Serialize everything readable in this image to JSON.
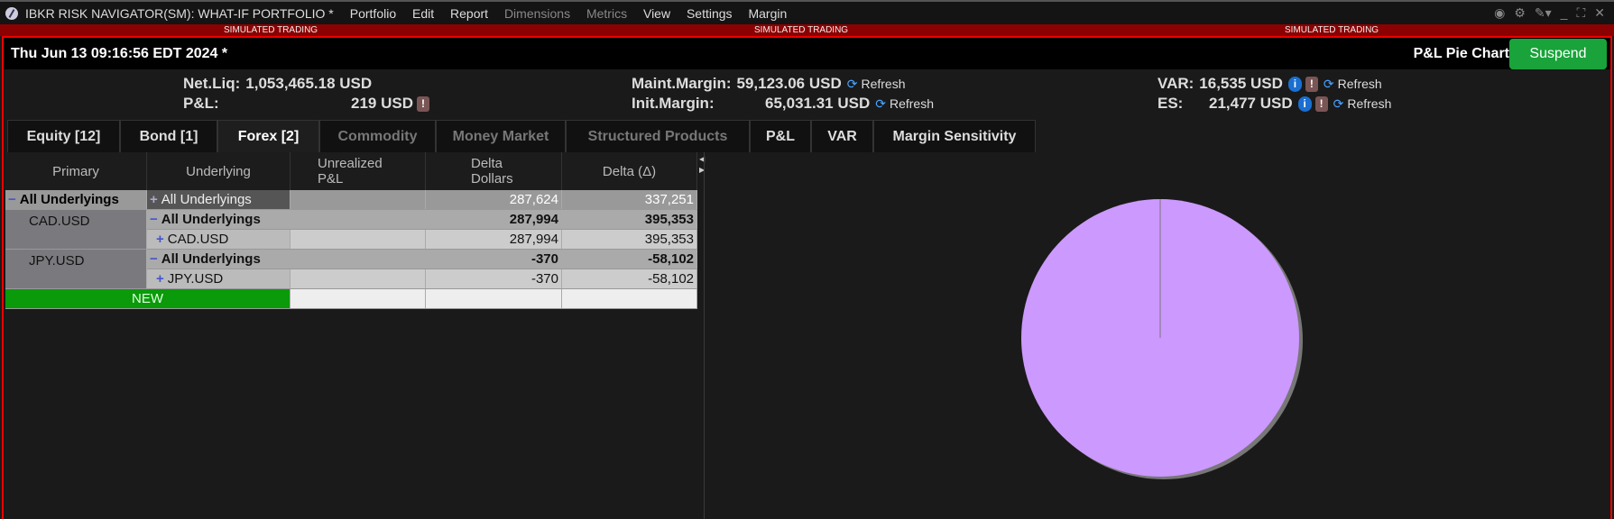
{
  "window": {
    "title": "IBKR RISK NAVIGATOR(SM): WHAT-IF PORTFOLIO *",
    "menu": [
      {
        "label": "Portfolio",
        "enabled": true
      },
      {
        "label": "Edit",
        "enabled": true
      },
      {
        "label": "Report",
        "enabled": true
      },
      {
        "label": "Dimensions",
        "enabled": false
      },
      {
        "label": "Metrics",
        "enabled": false
      },
      {
        "label": "View",
        "enabled": true
      },
      {
        "label": "Settings",
        "enabled": true
      },
      {
        "label": "Margin",
        "enabled": true
      }
    ]
  },
  "sim_banner": "SIMULATED TRADING",
  "header": {
    "datetime": "Thu Jun 13 09:16:56 EDT 2024 *",
    "panel_name": "P&L Pie Chart",
    "suspend_label": "Suspend"
  },
  "metrics": {
    "net_liq_label": "Net.Liq:",
    "net_liq": "1,053,465.18 USD",
    "pnl_label": "P&L:",
    "pnl": "219 USD",
    "maint_label": "Maint.Margin:",
    "maint": "59,123.06 USD",
    "init_label": "Init.Margin:",
    "init": "65,031.31 USD",
    "var_label": "VAR:",
    "var": "16,535 USD",
    "es_label": "ES:",
    "es": "21,477 USD",
    "refresh": "Refresh"
  },
  "tabs": [
    {
      "label": "Equity [12]"
    },
    {
      "label": "Bond [1]"
    },
    {
      "label": "Forex [2]",
      "active": true
    },
    {
      "label": "Commodity",
      "disabled": true
    },
    {
      "label": "Money Market",
      "disabled": true
    },
    {
      "label": "Structured Products",
      "disabled": true
    },
    {
      "label": "P&L"
    },
    {
      "label": "VAR"
    },
    {
      "label": "Margin Sensitivity"
    }
  ],
  "table": {
    "columns": [
      "Primary",
      "Underlying",
      "Unrealized P&L",
      "Delta Dollars",
      "Delta (Δ)"
    ],
    "rows": [
      {
        "primary": "All Underlyings",
        "underlying": "All Underlyings",
        "upnl": "",
        "dd": "287,624",
        "delta": "337,251"
      },
      {
        "primary": "CAD.USD",
        "underlying": "All Underlyings",
        "upnl": "",
        "dd": "287,994",
        "delta": "395,353"
      },
      {
        "primary": "",
        "underlying": "CAD.USD",
        "upnl": "",
        "dd": "287,994",
        "delta": "395,353"
      },
      {
        "primary": "JPY.USD",
        "underlying": "All Underlyings",
        "upnl": "",
        "dd": "-370",
        "delta": "-58,102"
      },
      {
        "primary": "",
        "underlying": "JPY.USD",
        "upnl": "",
        "dd": "-370",
        "delta": "-58,102"
      }
    ],
    "new_label": "NEW"
  },
  "pie": {
    "color": "#cc99ff",
    "share": 1.0
  },
  "colors": {
    "accent_green": "#19a33a",
    "sim_red": "#8b0000"
  }
}
